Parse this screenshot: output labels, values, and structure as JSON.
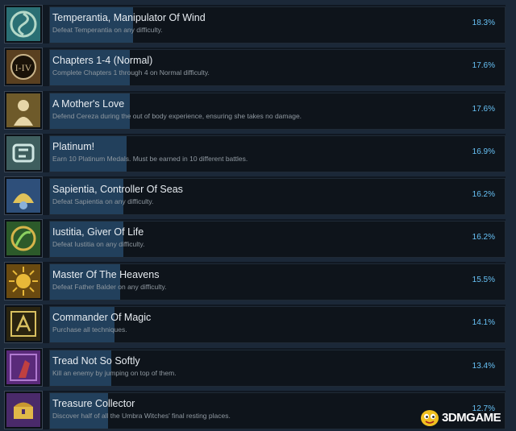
{
  "achievements": [
    {
      "title": "Temperantia, Manipulator Of Wind",
      "description": "Defeat Temperantia on any difficulty.",
      "percent": "18.3%",
      "percent_value": 18.3,
      "icon": "wind-swirl-icon",
      "icon_colors": [
        "#2a6f74",
        "#b4d8c8"
      ]
    },
    {
      "title": "Chapters 1-4 (Normal)",
      "description": "Complete Chapters 1 through 4 on Normal difficulty.",
      "percent": "17.6%",
      "percent_value": 17.6,
      "icon": "clock-chapters-icon",
      "icon_colors": [
        "#5a4020",
        "#c9b48a"
      ]
    },
    {
      "title": "A Mother's Love",
      "description": "Defend Cereza during the out of body experience, ensuring she takes no damage.",
      "percent": "17.6%",
      "percent_value": 17.6,
      "icon": "mother-figure-icon",
      "icon_colors": [
        "#6e5a2a",
        "#e6d6a8"
      ]
    },
    {
      "title": "Platinum!",
      "description": "Earn 10 Platinum Medals. Must be earned in 10 different battles.",
      "percent": "16.9%",
      "percent_value": 16.9,
      "icon": "platinum-medal-icon",
      "icon_colors": [
        "#3e5e5e",
        "#cfe6e2"
      ]
    },
    {
      "title": "Sapientia, Controller Of Seas",
      "description": "Defeat Sapientia on any difficulty.",
      "percent": "16.2%",
      "percent_value": 16.2,
      "icon": "sea-creature-icon",
      "icon_colors": [
        "#2e4f7a",
        "#e0c25a"
      ]
    },
    {
      "title": "Iustitia, Giver Of Life",
      "description": "Defeat Iustitia on any difficulty.",
      "percent": "16.2%",
      "percent_value": 16.2,
      "icon": "life-vine-icon",
      "icon_colors": [
        "#2c5a2a",
        "#d6b44a"
      ]
    },
    {
      "title": "Master Of The Heavens",
      "description": "Defeat Father Balder on any difficulty.",
      "percent": "15.5%",
      "percent_value": 15.5,
      "icon": "sun-icon",
      "icon_colors": [
        "#6a4a10",
        "#e8b838"
      ]
    },
    {
      "title": "Commander Of Magic",
      "description": "Purchase all techniques.",
      "percent": "14.1%",
      "percent_value": 14.1,
      "icon": "magic-runes-icon",
      "icon_colors": [
        "#2a2410",
        "#d8c060"
      ]
    },
    {
      "title": "Tread Not So Softly",
      "description": "Kill an enemy by jumping on top of them.",
      "percent": "13.4%",
      "percent_value": 13.4,
      "icon": "stomp-figure-icon",
      "icon_colors": [
        "#5a2a7a",
        "#b07ad0"
      ]
    },
    {
      "title": "Treasure Collector",
      "description": "Discover half of all the Umbra Witches' final resting places.",
      "percent": "12.7%",
      "percent_value": 12.7,
      "icon": "treasure-chest-icon",
      "icon_colors": [
        "#4a2a6a",
        "#e0b848"
      ]
    }
  ],
  "colors": {
    "background": "#1b2838",
    "bar_fill": "#22405c",
    "percent_text": "#67c1f5"
  },
  "watermark": {
    "text": "3DMGAME",
    "logo": "3dm-mascot-logo"
  }
}
